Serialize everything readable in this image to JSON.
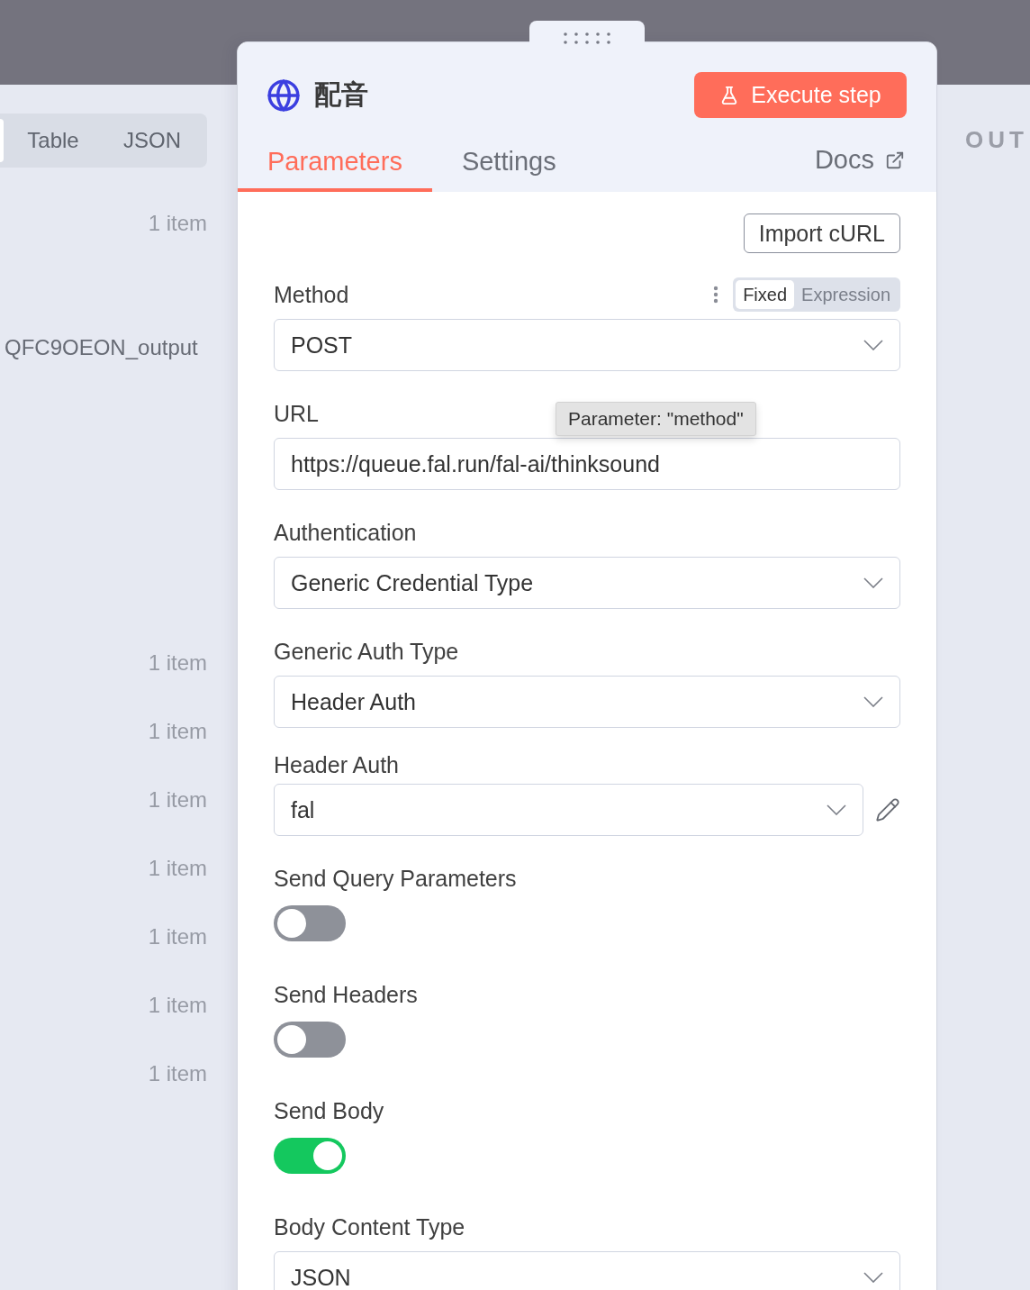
{
  "input_pane": {
    "view_tabs": [
      {
        "label": "Table",
        "selected": false
      },
      {
        "label": "JSON",
        "selected": false
      }
    ],
    "rows": [
      {
        "kind": "count",
        "text": "1 item"
      },
      {
        "kind": "name",
        "text": "QFC9OEON_output"
      },
      {
        "kind": "count",
        "text": "1 item"
      },
      {
        "kind": "count",
        "text": "1 item"
      },
      {
        "kind": "count",
        "text": "1 item"
      },
      {
        "kind": "count",
        "text": "1 item"
      },
      {
        "kind": "count",
        "text": "1 item"
      },
      {
        "kind": "count",
        "text": "1 item"
      },
      {
        "kind": "count",
        "text": "1 item"
      }
    ]
  },
  "node_panel": {
    "title": "配音",
    "execute_button": "Execute step",
    "tabs": [
      {
        "label": "Parameters",
        "selected": true
      },
      {
        "label": "Settings",
        "selected": false
      }
    ],
    "docs_link": "Docs",
    "import_button": "Import cURL",
    "fields": [
      {
        "kind": "select",
        "label": "Method",
        "value": "POST",
        "mode_toggle": [
          {
            "label": "Fixed",
            "selected": true
          },
          {
            "label": "Expression",
            "selected": false
          }
        ],
        "tooltip": "Parameter: \"method\""
      },
      {
        "kind": "input",
        "label": "URL",
        "value": "https://queue.fal.run/fal-ai/thinksound"
      },
      {
        "kind": "select",
        "label": "Authentication",
        "value": "Generic Credential Type"
      },
      {
        "kind": "select",
        "label": "Generic Auth Type",
        "value": "Header Auth"
      },
      {
        "kind": "credential",
        "label": "Header Auth",
        "value": "fal"
      },
      {
        "kind": "toggle",
        "label": "Send Query Parameters",
        "on": false
      },
      {
        "kind": "toggle",
        "label": "Send Headers",
        "on": false
      },
      {
        "kind": "toggle",
        "label": "Send Body",
        "on": true
      },
      {
        "kind": "select",
        "label": "Body Content Type",
        "value": "JSON"
      }
    ]
  },
  "output_pane": {
    "title": "OUT"
  }
}
